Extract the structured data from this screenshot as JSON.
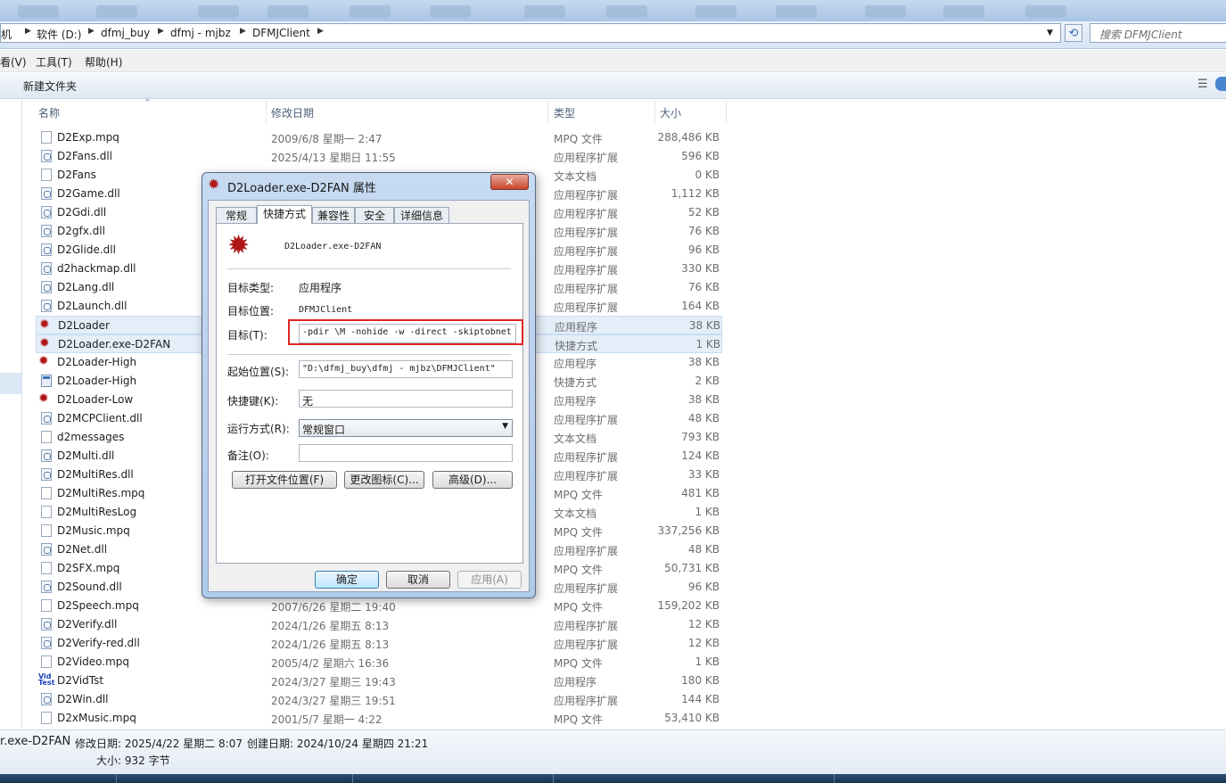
{
  "address_bar": {
    "crumbs": [
      "机",
      "软件 (D:)",
      "dfmj_buy",
      "dfmj - mjbz",
      "DFMJClient"
    ],
    "search_placeholder": "搜索 DFMJClient"
  },
  "menu": [
    "看(V)",
    "工具(T)",
    "帮助(H)"
  ],
  "toolbar": {
    "new_folder": "新建文件夹"
  },
  "columns": {
    "name": "名称",
    "date": "修改日期",
    "type": "类型",
    "size": "大小"
  },
  "files": [
    {
      "name": "D2Exp.mpq",
      "date": "2009/6/8 星期一 2:47",
      "type": "MPQ 文件",
      "size": "288,486 KB",
      "icon": "doc"
    },
    {
      "name": "D2Fans.dll",
      "date": "2025/4/13 星期日 11:55",
      "type": "应用程序扩展",
      "size": "596 KB",
      "icon": "dll"
    },
    {
      "name": "D2Fans",
      "date": "",
      "type": "文本文档",
      "size": "0 KB",
      "icon": "doc"
    },
    {
      "name": "D2Game.dll",
      "date": "",
      "type": "应用程序扩展",
      "size": "1,112 KB",
      "icon": "dll"
    },
    {
      "name": "D2Gdi.dll",
      "date": "",
      "type": "应用程序扩展",
      "size": "52 KB",
      "icon": "dll"
    },
    {
      "name": "D2gfx.dll",
      "date": "",
      "type": "应用程序扩展",
      "size": "76 KB",
      "icon": "dll"
    },
    {
      "name": "D2Glide.dll",
      "date": "",
      "type": "应用程序扩展",
      "size": "96 KB",
      "icon": "dll"
    },
    {
      "name": "d2hackmap.dll",
      "date": "",
      "type": "应用程序扩展",
      "size": "330 KB",
      "icon": "dll"
    },
    {
      "name": "D2Lang.dll",
      "date": "",
      "type": "应用程序扩展",
      "size": "76 KB",
      "icon": "dll"
    },
    {
      "name": "D2Launch.dll",
      "date": "",
      "type": "应用程序扩展",
      "size": "164 KB",
      "icon": "dll"
    },
    {
      "name": "D2Loader",
      "date": "",
      "type": "应用程序",
      "size": "38 KB",
      "icon": "app",
      "selected": true
    },
    {
      "name": "D2Loader.exe-D2FAN",
      "date": "",
      "type": "快捷方式",
      "size": "1 KB",
      "icon": "app",
      "selected": true
    },
    {
      "name": "D2Loader-High",
      "date": "",
      "type": "应用程序",
      "size": "38 KB",
      "icon": "app"
    },
    {
      "name": "D2Loader-High",
      "date": "",
      "type": "快捷方式",
      "size": "2 KB",
      "icon": "win"
    },
    {
      "name": "D2Loader-Low",
      "date": "",
      "type": "应用程序",
      "size": "38 KB",
      "icon": "app"
    },
    {
      "name": "D2MCPClient.dll",
      "date": "",
      "type": "应用程序扩展",
      "size": "48 KB",
      "icon": "dll"
    },
    {
      "name": "d2messages",
      "date": "",
      "type": "文本文档",
      "size": "793 KB",
      "icon": "doc"
    },
    {
      "name": "D2Multi.dll",
      "date": "",
      "type": "应用程序扩展",
      "size": "124 KB",
      "icon": "dll"
    },
    {
      "name": "D2MultiRes.dll",
      "date": "",
      "type": "应用程序扩展",
      "size": "33 KB",
      "icon": "dll"
    },
    {
      "name": "D2MultiRes.mpq",
      "date": "",
      "type": "MPQ 文件",
      "size": "481 KB",
      "icon": "doc"
    },
    {
      "name": "D2MultiResLog",
      "date": "",
      "type": "文本文档",
      "size": "1 KB",
      "icon": "doc"
    },
    {
      "name": "D2Music.mpq",
      "date": "",
      "type": "MPQ 文件",
      "size": "337,256 KB",
      "icon": "doc"
    },
    {
      "name": "D2Net.dll",
      "date": "",
      "type": "应用程序扩展",
      "size": "48 KB",
      "icon": "dll"
    },
    {
      "name": "D2SFX.mpq",
      "date": "",
      "type": "MPQ 文件",
      "size": "50,731 KB",
      "icon": "doc"
    },
    {
      "name": "D2Sound.dll",
      "date": "",
      "type": "应用程序扩展",
      "size": "96 KB",
      "icon": "dll"
    },
    {
      "name": "D2Speech.mpq",
      "date": "2007/6/26 星期二 19:40",
      "type": "MPQ 文件",
      "size": "159,202 KB",
      "icon": "doc"
    },
    {
      "name": "D2Verify.dll",
      "date": "2024/1/26 星期五 8:13",
      "type": "应用程序扩展",
      "size": "12 KB",
      "icon": "dll"
    },
    {
      "name": "D2Verify-red.dll",
      "date": "2024/1/26 星期五 8:13",
      "type": "应用程序扩展",
      "size": "12 KB",
      "icon": "dll"
    },
    {
      "name": "D2Video.mpq",
      "date": "2005/4/2 星期六 16:36",
      "type": "MPQ 文件",
      "size": "1 KB",
      "icon": "doc"
    },
    {
      "name": "D2VidTst",
      "date": "2024/3/27 星期三 19:43",
      "type": "应用程序",
      "size": "180 KB",
      "icon": "vid"
    },
    {
      "name": "D2Win.dll",
      "date": "2024/3/27 星期三 19:51",
      "type": "应用程序扩展",
      "size": "144 KB",
      "icon": "dll"
    },
    {
      "name": "D2xMusic.mpq",
      "date": "2001/5/7 星期一 4:22",
      "type": "MPQ 文件",
      "size": "53,410 KB",
      "icon": "doc"
    }
  ],
  "details": {
    "name": "r.exe-D2FAN",
    "modified": "修改日期: 2025/4/22 星期二 8:07",
    "created": "创建日期: 2024/10/24 星期四 21:21",
    "size": "大小: 932 字节"
  },
  "dialog": {
    "title": "D2Loader.exe-D2FAN 属性",
    "close": "✕",
    "tabs": [
      "常规",
      "快捷方式",
      "兼容性",
      "安全",
      "详细信息"
    ],
    "active_tab": 1,
    "shortcut_name": "D2Loader.exe-D2FAN",
    "target_type_label": "目标类型:",
    "target_type": "应用程序",
    "target_location_label": "目标位置:",
    "target_location": "DFMJClient",
    "target_label": "目标(T):",
    "target_value": "-pdir \\M -nohide -w -direct -skiptobnet",
    "start_in_label": "起始位置(S):",
    "start_in_value": "\"D:\\dfmj_buy\\dfmj - mjbz\\DFMJClient\"",
    "hotkey_label": "快捷键(K):",
    "hotkey_value": "无",
    "run_label": "运行方式(R):",
    "run_value": "常规窗口",
    "comment_label": "备注(O):",
    "comment_value": "",
    "open_location_btn": "打开文件位置(F)",
    "change_icon_btn": "更改图标(C)...",
    "advanced_btn": "高级(D)...",
    "ok_btn": "确定",
    "cancel_btn": "取消",
    "apply_btn": "应用(A)",
    "highlight_color": "#e02424"
  }
}
